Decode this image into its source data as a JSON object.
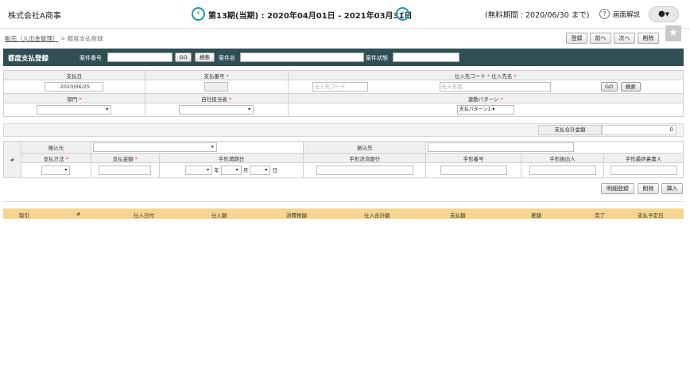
{
  "header": {
    "company": "株式会社A商事",
    "period": "第13期(当期) : 2020年04月01日 - 2021年03月31日",
    "trial": "(無料期間 : 2020/06/30 まで)",
    "help_label": "画面解説",
    "prev_icon": "chevron-left-icon",
    "next_icon": "chevron-right-icon"
  },
  "breadcrumb": {
    "parent": "販売（入出金管理）",
    "sep": ">",
    "current": "都度支払登録"
  },
  "toolbar": {
    "register": "登録",
    "prev": "前へ",
    "next": "次へ",
    "delete": "削除"
  },
  "titlebar": {
    "title": "都度支払登録",
    "case_no_label": "案件番号",
    "go": "GO",
    "search": "検索",
    "case_name_label": "案件名",
    "case_status_label": "案件状態"
  },
  "form1": {
    "pay_date_label": "支払日",
    "pay_date_value": "2020/06/25",
    "pay_no_label": "支払番号",
    "supplier_label": "仕入先コード",
    "supplier_name_label": "仕入先名",
    "supplier_code_ph": "仕入先コード",
    "supplier_name_ph": "仕入先名",
    "go": "GO",
    "search": "検索",
    "dept_label": "部門",
    "staff_label": "自社担当者",
    "pattern_label": "連動パターン",
    "pattern_value": "支払パターン1"
  },
  "summary": {
    "total_label": "支払合計金額",
    "total_value": "0"
  },
  "form2": {
    "hash": "#",
    "transfer_from": "振込元",
    "transfer_to": "振込先",
    "method_label": "支払方法",
    "amount_label": "支払金額",
    "due_label": "手形満期日",
    "year": "年",
    "month": "月",
    "day": "日",
    "bank_label": "手形決済銀行",
    "note_no_label": "手形番号",
    "drawer_label": "手形振出人",
    "endorser_label": "手形最終裏書人"
  },
  "rowbtns": {
    "detail": "明細登録",
    "delete": "削除",
    "insert": "挿入"
  },
  "list_columns": [
    "取引",
    "#",
    "仕入日付",
    "仕入額",
    "消費税額",
    "仕入合計額",
    "支払額",
    "差額",
    "完了",
    "支払予定日"
  ]
}
